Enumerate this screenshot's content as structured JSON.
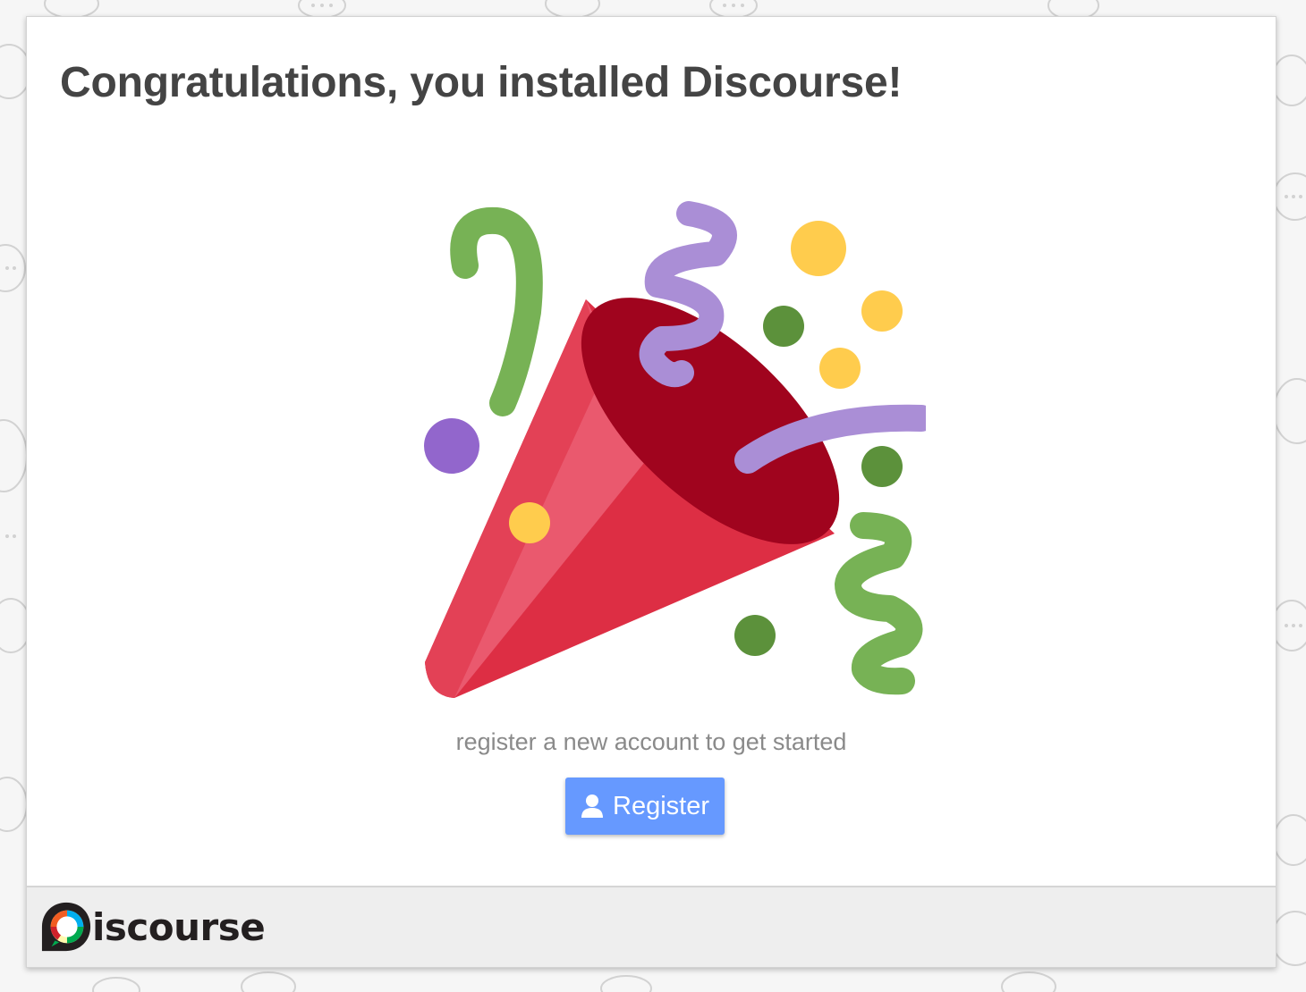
{
  "page": {
    "title": "Congratulations, you installed Discourse!",
    "subtitle": "register a new account to get started"
  },
  "register_button": {
    "label": "Register",
    "icon": "user-icon",
    "color": "#6699ff"
  },
  "footer": {
    "logo_wordmark": "iscourse",
    "logo_text": "Discourse"
  },
  "colors": {
    "title": "#444444",
    "subtitle": "#8a8a8a",
    "party_popper_red": "#dd2e44",
    "confetti_green": "#77b255",
    "confetti_purple": "#aa8ed6",
    "confetti_yellow": "#ffcc4d"
  },
  "illustration": {
    "icon": "party-popper-icon"
  }
}
